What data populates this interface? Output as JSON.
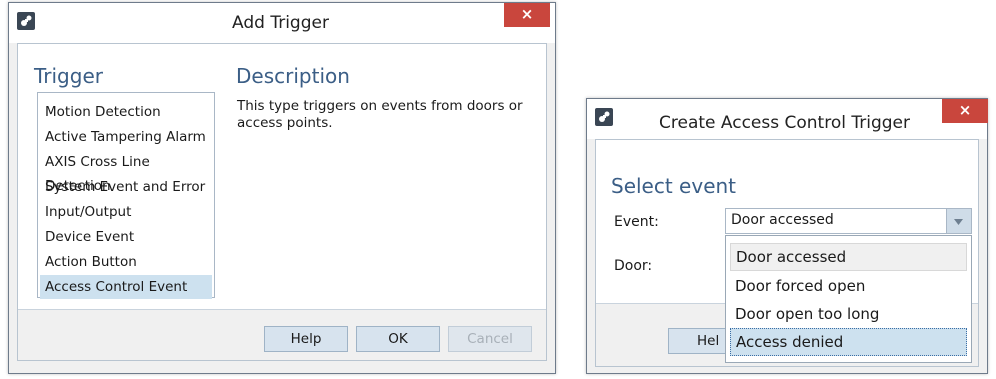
{
  "add_trigger": {
    "title": "Add Trigger",
    "close": "×",
    "trigger_heading": "Trigger",
    "description_heading": "Description",
    "description_text_line1": "This type triggers on events from doors or",
    "description_text_line2": "access points.",
    "trigger_types": [
      "Motion Detection",
      "Active Tampering Alarm",
      "AXIS Cross Line Detection",
      "System Event and Error",
      "Input/Output",
      "Device Event",
      "Action Button",
      "Access Control Event"
    ],
    "selected_index": 7,
    "buttons": {
      "help": "Help",
      "ok": "OK",
      "cancel": "Cancel"
    }
  },
  "create_trigger": {
    "title": "Create Access Control Trigger",
    "close": "×",
    "heading": "Select event",
    "event_label": "Event:",
    "door_label": "Door:",
    "event_value": "Door accessed",
    "event_options": [
      "Door accessed",
      "Door forced open",
      "Door open too long",
      "Access denied"
    ],
    "help_partial": "Hel"
  },
  "colors": {
    "accent_heading": "#3b5e86",
    "close_red": "#c9463d",
    "selection": "#cde1ef"
  },
  "icons": {
    "app": "axis-camera-station-icon",
    "dropdown": "chevron-down-icon"
  }
}
